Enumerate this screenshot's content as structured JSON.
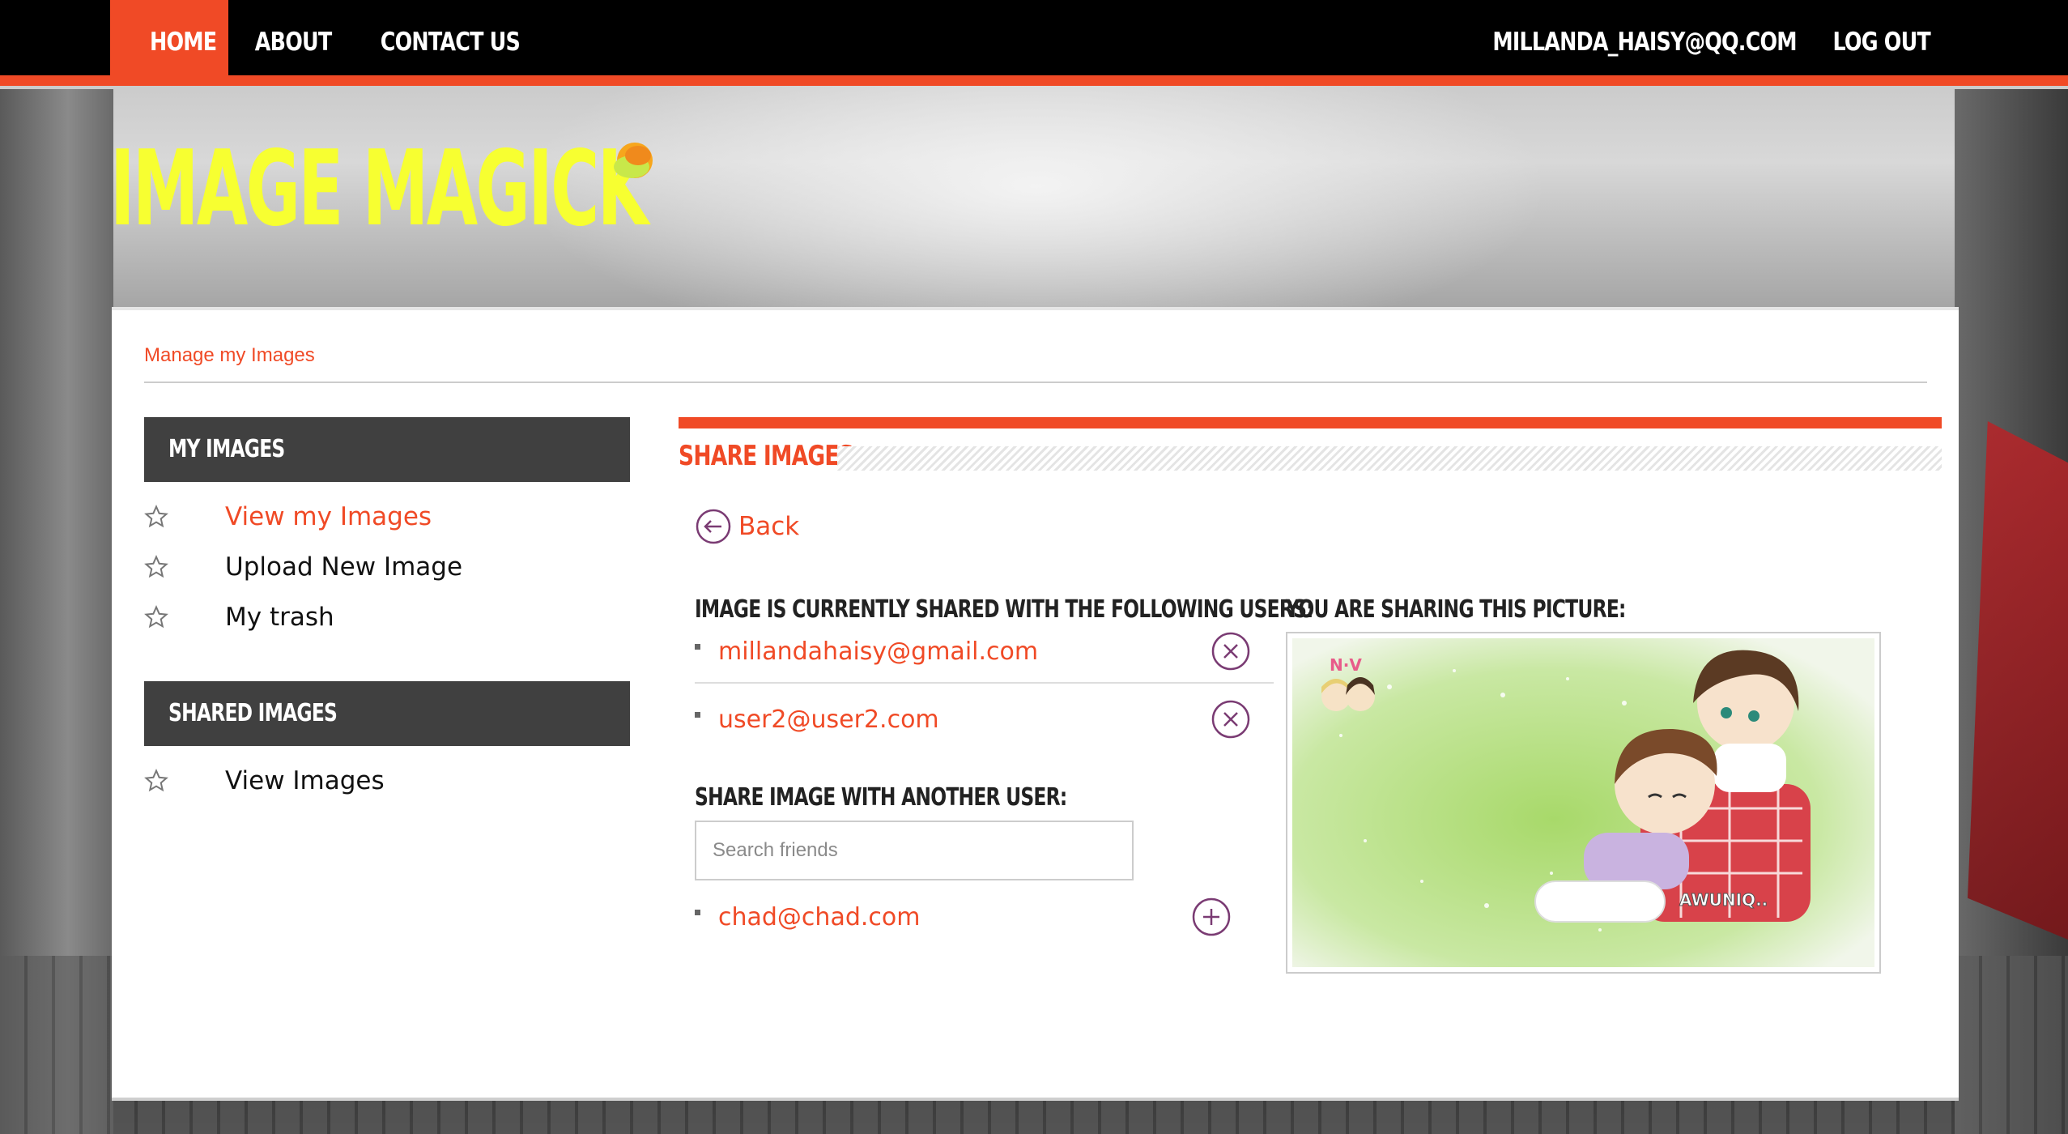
{
  "nav": {
    "left": [
      "HOME",
      "ABOUT",
      "CONTACT US"
    ],
    "user_email": "MILLANDA_HAISY@QQ.COM",
    "logout": "LOG OUT"
  },
  "logo": {
    "text": "IMAGE MAGICK"
  },
  "breadcrumb": "Manage my Images",
  "sidebar": {
    "my_images_title": "MY IMAGES",
    "my_images_items": [
      "View my Images",
      "Upload New Image",
      "My trash"
    ],
    "shared_title": "SHARED IMAGES",
    "shared_items": [
      "View Images"
    ]
  },
  "content": {
    "title": "SHARE IMAGES",
    "back": "Back",
    "shared_with_title": "IMAGE IS CURRENTLY SHARED WITH THE FOLLOWING USERS:",
    "shared_users": [
      "millandahaisy@gmail.com",
      "user2@user2.com"
    ],
    "share_title": "SHARE IMAGE WITH ANOTHER USER:",
    "search_placeholder": "Search friends",
    "suggested_users": [
      "chad@chad.com"
    ],
    "picture_title": "YOU ARE SHARING THIS PICTURE:",
    "picture_watermark": "AWUNIQ.."
  },
  "colors": {
    "accent": "#f04a26",
    "logo": "#f7ff31",
    "dark": "#404040",
    "icon": "#7a3b73"
  }
}
